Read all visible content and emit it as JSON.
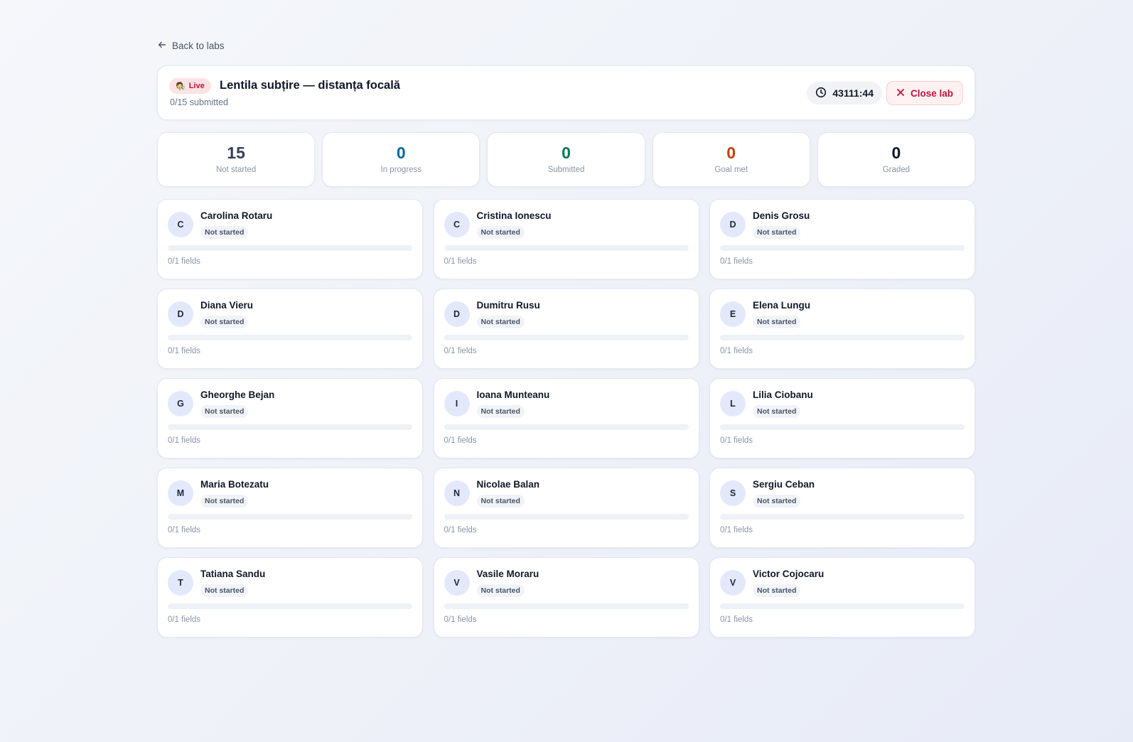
{
  "nav": {
    "back_label": "Back to labs"
  },
  "header": {
    "badge": "Live",
    "badge_icon": "🧑‍🔬",
    "title": "Lentila subțire — distanța focală",
    "subtitle": "0/15 submitted",
    "timer": "43111:44",
    "close_label": "Close lab"
  },
  "stats": [
    {
      "value": "15",
      "label": "Not started",
      "color": "#334155"
    },
    {
      "value": "0",
      "label": "In progress",
      "color": "#0369a1"
    },
    {
      "value": "0",
      "label": "Submitted",
      "color": "#047857"
    },
    {
      "value": "0",
      "label": "Goal met",
      "color": "#c2410c"
    },
    {
      "value": "0",
      "label": "Graded",
      "color": "#0f172a"
    }
  ],
  "students": [
    {
      "initial": "C",
      "name": "Carolina Rotaru",
      "status": "Not started",
      "fields": "0/1 fields",
      "progress": 0
    },
    {
      "initial": "C",
      "name": "Cristina Ionescu",
      "status": "Not started",
      "fields": "0/1 fields",
      "progress": 0
    },
    {
      "initial": "D",
      "name": "Denis Grosu",
      "status": "Not started",
      "fields": "0/1 fields",
      "progress": 0
    },
    {
      "initial": "D",
      "name": "Diana Vieru",
      "status": "Not started",
      "fields": "0/1 fields",
      "progress": 0
    },
    {
      "initial": "D",
      "name": "Dumitru Rusu",
      "status": "Not started",
      "fields": "0/1 fields",
      "progress": 0
    },
    {
      "initial": "E",
      "name": "Elena Lungu",
      "status": "Not started",
      "fields": "0/1 fields",
      "progress": 0
    },
    {
      "initial": "G",
      "name": "Gheorghe Bejan",
      "status": "Not started",
      "fields": "0/1 fields",
      "progress": 0
    },
    {
      "initial": "I",
      "name": "Ioana Munteanu",
      "status": "Not started",
      "fields": "0/1 fields",
      "progress": 0
    },
    {
      "initial": "L",
      "name": "Lilia Ciobanu",
      "status": "Not started",
      "fields": "0/1 fields",
      "progress": 0
    },
    {
      "initial": "M",
      "name": "Maria Botezatu",
      "status": "Not started",
      "fields": "0/1 fields",
      "progress": 0
    },
    {
      "initial": "N",
      "name": "Nicolae Balan",
      "status": "Not started",
      "fields": "0/1 fields",
      "progress": 0
    },
    {
      "initial": "S",
      "name": "Sergiu Ceban",
      "status": "Not started",
      "fields": "0/1 fields",
      "progress": 0
    },
    {
      "initial": "T",
      "name": "Tatiana Sandu",
      "status": "Not started",
      "fields": "0/1 fields",
      "progress": 0
    },
    {
      "initial": "V",
      "name": "Vasile Moraru",
      "status": "Not started",
      "fields": "0/1 fields",
      "progress": 0
    },
    {
      "initial": "V",
      "name": "Victor Cojocaru",
      "status": "Not started",
      "fields": "0/1 fields",
      "progress": 0
    }
  ]
}
